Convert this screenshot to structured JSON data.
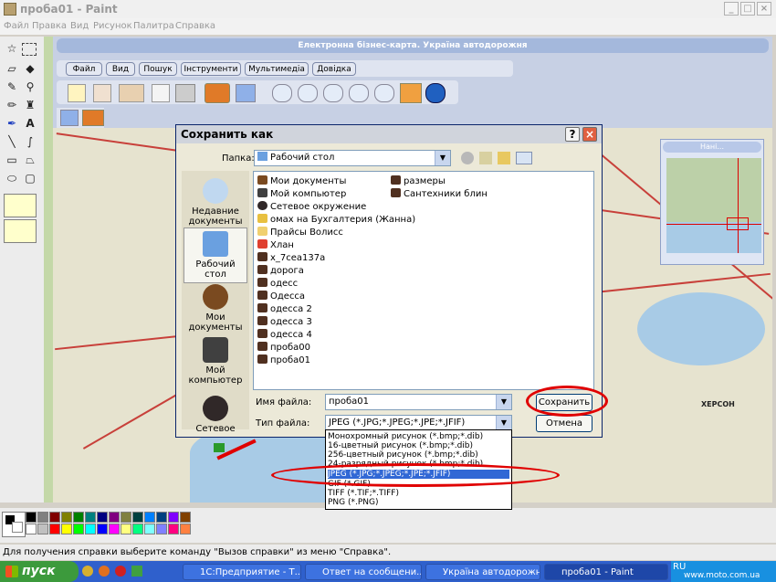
{
  "window": {
    "title": "проба01 - Paint",
    "min": "_",
    "max": "□",
    "close": "×"
  },
  "menu": [
    "Файл",
    "Правка",
    "Вид",
    "Рисунок",
    "Палитра",
    "Справка"
  ],
  "inner_app": {
    "title": "Електронна бізнес-карта. Україна автодорожня",
    "menu": [
      "Файл",
      "Вид",
      "Пошук",
      "Інструменти",
      "Мультимедіа",
      "Довідка"
    ],
    "overview_title": "Нані...",
    "city_label": "ХЕРСОН"
  },
  "dialog": {
    "title": "Сохранить как",
    "help": "?",
    "close": "×",
    "folder_label": "Папка:",
    "folder_value": "Рабочий стол",
    "places": [
      "Недавние документы",
      "Рабочий стол",
      "Мои документы",
      "Мой компьютер",
      "Сетевое"
    ],
    "files_col1": [
      "Мои документы",
      "Мой компьютер",
      "Сетевое окружение",
      "омах на Бухгалтерия (Жанна)",
      "Прайсы Волисс",
      "Хлан",
      "x_7cea137a",
      "дорога",
      "одесс",
      "Одесса",
      "одесса 2",
      "одесса 3",
      "одесса 4",
      "проба00",
      "проба01"
    ],
    "files_col2": [
      "размеры",
      "Сантехники блин"
    ],
    "filename_label": "Имя файла:",
    "filename_value": "проба01",
    "filetype_label": "Тип файла:",
    "filetype_value": "JPEG (*.JPG;*.JPEG;*.JPE;*.JFIF)",
    "save": "Сохранить",
    "cancel": "Отмена",
    "filetype_options": [
      "Монохромный рисунок (*.bmp;*.dib)",
      "16-цветный рисунок (*.bmp;*.dib)",
      "256-цветный рисунок (*.bmp;*.dib)",
      "24-разрядный рисунок (*.bmp;*.dib)",
      "JPEG (*.JPG;*.JPEG;*.JPE;*.JFIF)",
      "GIF (*.GIF)",
      "TIFF (*.TIF;*.TIFF)",
      "PNG (*.PNG)"
    ],
    "selected_option": 4
  },
  "palette": [
    "#000000",
    "#808080",
    "#800000",
    "#808000",
    "#008000",
    "#008080",
    "#000080",
    "#800080",
    "#808040",
    "#004040",
    "#0080ff",
    "#004080",
    "#8000ff",
    "#804000",
    "#ffffff",
    "#c0c0c0",
    "#ff0000",
    "#ffff00",
    "#00ff00",
    "#00ffff",
    "#0000ff",
    "#ff00ff",
    "#ffff80",
    "#00ff80",
    "#80ffff",
    "#8080ff",
    "#ff0080",
    "#ff8040"
  ],
  "status": "Для получения справки выберите команду \"Вызов справки\" из меню \"Справка\".",
  "taskbar": {
    "start": "пуск",
    "tasks": [
      "1С:Предприятие - Т...",
      "Ответ на сообщени...",
      "Україна автодорожня",
      "проба01 - Paint"
    ],
    "tray_lang": "RU",
    "watermark": "www.moto.com.ua"
  }
}
